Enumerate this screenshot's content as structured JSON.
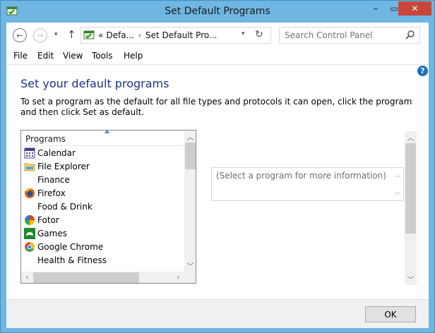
{
  "window": {
    "title": "Set Default Programs",
    "minimize": "–",
    "maximize": "▭",
    "close": "✕"
  },
  "navbar": {
    "back_icon": "←",
    "forward_icon": "→",
    "recent_icon": "▾",
    "up_icon": "↑",
    "breadcrumb_overflow": "«",
    "breadcrumbs": [
      "Defa...",
      "Set Default Pro..."
    ],
    "breadcrumb_separator": "›",
    "address_dropdown_icon": "▾",
    "refresh_icon": "↻",
    "search_placeholder": "Search Control Panel"
  },
  "menubar": {
    "items": [
      "File",
      "Edit",
      "View",
      "Tools",
      "Help"
    ]
  },
  "content": {
    "help_icon": "?",
    "heading": "Set your default programs",
    "description": "To set a program as the default for all file types and protocols it can open, click the program and then click Set as default.",
    "programs_header": "Programs",
    "programs": [
      {
        "label": "Calendar",
        "icon": "calendar-icon"
      },
      {
        "label": "File Explorer",
        "icon": "folder-icon"
      },
      {
        "label": "Finance",
        "icon": "none"
      },
      {
        "label": "Firefox",
        "icon": "firefox-icon"
      },
      {
        "label": "Food & Drink",
        "icon": "none"
      },
      {
        "label": "Fotor",
        "icon": "fotor-icon"
      },
      {
        "label": "Games",
        "icon": "games-icon"
      },
      {
        "label": "Google Chrome",
        "icon": "chrome-icon"
      },
      {
        "label": "Health & Fitness",
        "icon": "none"
      }
    ],
    "info_placeholder": "(Select a program for more information)"
  },
  "footer": {
    "ok_label": "OK"
  },
  "colors": {
    "title_bar": "#6fb6e3",
    "close_button": "#c7483b",
    "heading": "#1e3287"
  }
}
